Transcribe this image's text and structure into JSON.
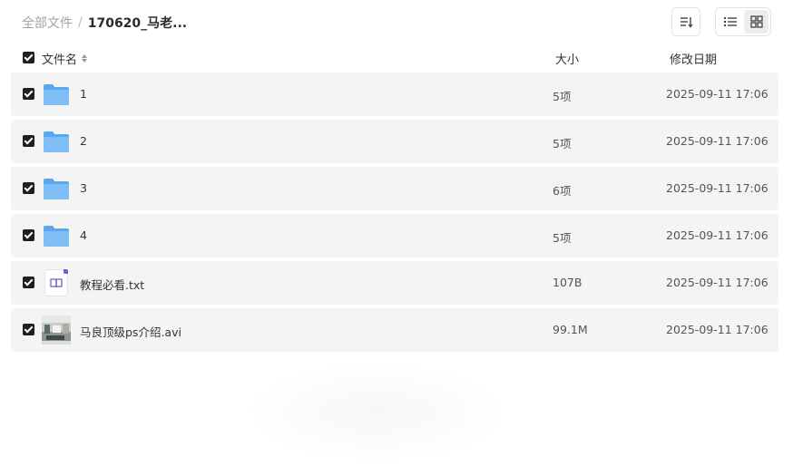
{
  "breadcrumb": {
    "root": "全部文件",
    "separator": "/",
    "current": "170620_马老..."
  },
  "toolbar": {
    "sort_icon": "sort-list-icon",
    "view_list_icon": "list-view-icon",
    "view_grid_icon": "grid-view-icon"
  },
  "table": {
    "headers": {
      "name": "文件名",
      "size": "大小",
      "modified": "修改日期"
    },
    "rows": [
      {
        "name": "1",
        "size": "5项",
        "date": "2025-09-11 17:06",
        "icon": "folder-icon",
        "checked": true
      },
      {
        "name": "2",
        "size": "5项",
        "date": "2025-09-11 17:06",
        "icon": "folder-icon",
        "checked": true
      },
      {
        "name": "3",
        "size": "6项",
        "date": "2025-09-11 17:06",
        "icon": "folder-icon",
        "checked": true
      },
      {
        "name": "4",
        "size": "5项",
        "date": "2025-09-11 17:06",
        "icon": "folder-icon",
        "checked": true
      },
      {
        "name": "教程必看.txt",
        "size": "107B",
        "date": "2025-09-11 17:06",
        "icon": "text-file-icon",
        "checked": true
      },
      {
        "name": "马良顶级ps介绍.avi",
        "size": "99.1M",
        "date": "2025-09-11 17:06",
        "icon": "video-thumbnail",
        "checked": true
      }
    ]
  },
  "colors": {
    "folder": "#5aa7ef",
    "row_bg": "#f4f4f4",
    "doc_accent": "#6b5fc9"
  }
}
